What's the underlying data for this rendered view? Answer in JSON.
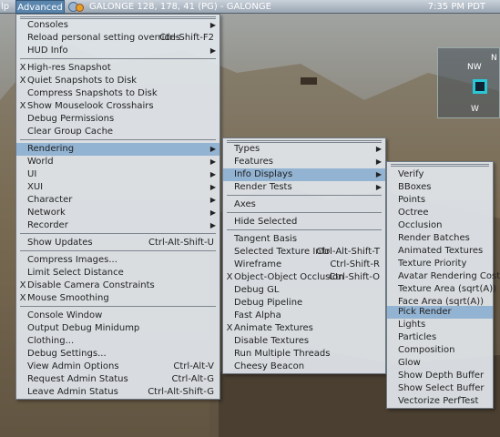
{
  "menubar": {
    "help_label": "lp",
    "advanced_label": "Advanced",
    "location": "GALONGE 128, 178, 41 (PG) - GALONGE",
    "clock": "7:35 PM PDT"
  },
  "advanced_menu": {
    "items": [
      {
        "label": "Consoles",
        "submenu": true
      },
      {
        "label": "Reload personal setting overrides",
        "shortcut": "Ctrl-Shift-F2"
      },
      {
        "label": "HUD Info",
        "submenu": true
      },
      {
        "label": "High-res Snapshot",
        "check": "X"
      },
      {
        "label": "Quiet Snapshots to Disk",
        "check": "X"
      },
      {
        "label": "Compress Snapshots to Disk"
      },
      {
        "label": "Show Mouselook Crosshairs",
        "check": "X"
      },
      {
        "label": "Debug Permissions"
      },
      {
        "label": "Clear Group Cache"
      },
      {
        "label": "Rendering",
        "submenu": true,
        "selected": true
      },
      {
        "label": "World",
        "submenu": true
      },
      {
        "label": "UI",
        "submenu": true
      },
      {
        "label": "XUI",
        "submenu": true
      },
      {
        "label": "Character",
        "submenu": true
      },
      {
        "label": "Network",
        "submenu": true
      },
      {
        "label": "Recorder",
        "submenu": true
      },
      {
        "label": "Show Updates",
        "shortcut": "Ctrl-Alt-Shift-U"
      },
      {
        "label": "Compress Images..."
      },
      {
        "label": "Limit Select Distance"
      },
      {
        "label": "Disable Camera Constraints",
        "check": "X"
      },
      {
        "label": "Mouse Smoothing",
        "check": "X"
      },
      {
        "label": "Console Window"
      },
      {
        "label": "Output Debug Minidump"
      },
      {
        "label": "Clothing..."
      },
      {
        "label": "Debug Settings..."
      },
      {
        "label": "View Admin Options",
        "shortcut": "Ctrl-Alt-V"
      },
      {
        "label": "Request Admin Status",
        "shortcut": "Ctrl-Alt-G"
      },
      {
        "label": "Leave Admin Status",
        "shortcut": "Ctrl-Alt-Shift-G"
      }
    ]
  },
  "rendering_menu": {
    "items": [
      {
        "label": "Types",
        "submenu": true
      },
      {
        "label": "Features",
        "submenu": true
      },
      {
        "label": "Info Displays",
        "submenu": true,
        "selected": true
      },
      {
        "label": "Render Tests",
        "submenu": true
      },
      {
        "label": "Axes"
      },
      {
        "label": "Hide Selected"
      },
      {
        "label": "Tangent Basis"
      },
      {
        "label": "Selected Texture Info",
        "shortcut": "Ctrl-Alt-Shift-T"
      },
      {
        "label": "Wireframe",
        "shortcut": "Ctrl-Shift-R"
      },
      {
        "label": "Object-Object Occlusion",
        "check": "X",
        "shortcut": "Ctrl-Shift-O"
      },
      {
        "label": "Debug GL"
      },
      {
        "label": "Debug Pipeline"
      },
      {
        "label": "Fast Alpha"
      },
      {
        "label": "Animate Textures",
        "check": "X"
      },
      {
        "label": "Disable Textures"
      },
      {
        "label": "Run Multiple Threads"
      },
      {
        "label": "Cheesy Beacon"
      }
    ]
  },
  "info_displays_menu": {
    "items": [
      {
        "label": "Verify"
      },
      {
        "label": "BBoxes"
      },
      {
        "label": "Points"
      },
      {
        "label": "Octree"
      },
      {
        "label": "Occlusion"
      },
      {
        "label": "Render Batches"
      },
      {
        "label": "Animated Textures"
      },
      {
        "label": "Texture Priority"
      },
      {
        "label": "Avatar Rendering Cost"
      },
      {
        "label": "Texture Area (sqrt(A))"
      },
      {
        "label": "Face Area (sqrt(A))"
      },
      {
        "label": "Pick Render",
        "selected": true
      },
      {
        "label": "Lights"
      },
      {
        "label": "Particles"
      },
      {
        "label": "Composition"
      },
      {
        "label": "Glow"
      },
      {
        "label": "Show Depth Buffer"
      },
      {
        "label": "Show Select Buffer"
      },
      {
        "label": "Vectorize PerfTest"
      }
    ]
  },
  "minimap": {
    "nw": "NW",
    "n": "N",
    "w": "W"
  },
  "colors": {
    "highlight": "#92b3d2",
    "menubar": "#9aa6b3",
    "menu_bg": "#e1e6ec"
  }
}
